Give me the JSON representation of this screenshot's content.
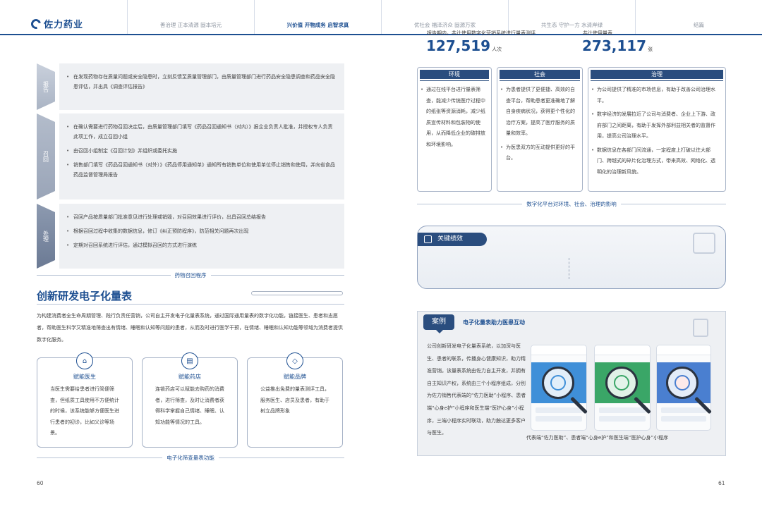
{
  "header": {
    "brand": "佐力药业",
    "nav": [
      "善治理 正本清源 固本培元",
      "兴价值 开物成务 启智求真",
      "优社会 福泽济众 固源万家",
      "共生态 守护一方 水清岸绿",
      "结篇"
    ],
    "active_index": 1
  },
  "recall": {
    "stages": [
      {
        "label": "报告",
        "items": [
          "在发现药物存在质量问题或安全隐患时，立刻反馈至质量管理部门，由质量管理部门进行药品安全隐患调查和药品安全隐患评估，并出具《调查评估报告》"
        ]
      },
      {
        "label": "召回",
        "items": [
          "在确认需要进行药物召回决定后，由质量管理部门填写《药品召回通知书（对内）》报企业负责人批准，并授权专人负责此项工作，成立召回小组",
          "由召回小组制定《召回计划》并组织或委托实施",
          "销售部门填写《药品召回通知书（对外）》《药品停用通知单》通知所有销售单位和使用单位停止销售和使用，并向省食品药品监督管理局报告"
        ]
      },
      {
        "label": "处理",
        "items": [
          "召回产品按质量部门批准意见进行处理或销毁，对召回效果进行评价，出具召回总结报告",
          "根据召回过程中收集的数据信息，修订《纠正预防程序》，防范相关问题再次出现",
          "定期对召回系统进行评估，通过模拟召回的方式进行演练"
        ]
      }
    ],
    "caption": "药物召回程序"
  },
  "scale_section": {
    "title": "创新研发电子化量表",
    "intro": "为构建消费者全生命周期管理、践行负责任营销，公司自主开发电子化量表系统，通过国际通用量表的数字化功能，链接医生、患者和志愿者，帮助医生科学又精准地筛查出有情绪、睡眠和认知等问题的患者，从而及时进行医学干预，在情绪、睡眠和认知功能等领域为消费者提供数字化服务。",
    "cards": [
      {
        "icon": "hospital-icon",
        "title": "赋能医生",
        "text": "当医生需要给患者进行简便筛查，但纸质工具使用不方便统计的时候，该系统能够方便医生进行患者的初诊，比如义诊等场景。"
      },
      {
        "icon": "store-icon",
        "title": "赋能药店",
        "text": "连锁药店可以赋能去购药的消费者，进行筛查，及时让消费者获得科学掌握自己情绪、睡眠、认知功能等情况的工具。"
      },
      {
        "icon": "diamond-icon",
        "title": "赋能品牌",
        "text": "公益推出免费的量表测评工具，服务医生、店员及患者，有助于树立品牌形象"
      }
    ],
    "caption": "电子化筛查量表功能"
  },
  "impact": {
    "columns": [
      {
        "title": "环境",
        "items": [
          "通过在线平台进行量表筛查，能减少传统医疗过程中的纸张等资源消耗，减少纸质宣传材料和包装物的使用，从而降低企业的碳排放和环境影响。"
        ]
      },
      {
        "title": "社会",
        "items": [
          "为患者提供了更便捷、高效的自查平台，帮助患者更准确地了解自身疾病状况，获得更个性化的治疗方案，提高了医疗服务的质量和效率。",
          "为医患双方的互动提供更好的平台。"
        ]
      },
      {
        "title": "治理",
        "items": [
          "为公司提供了精准的市场信息，有助于改善公司治理水平。",
          "数字经济的发展拉近了公司与消费者、企业上下游、政府部门之间距离，有助于发挥外部利益相关者的监督作用，提高公司治理水平。",
          "数据信息在各部门间流通，一定程度上打破以往大部门、跨越式的碎片化治理方式，带来高效、网络化、透明化的治理新风貌。"
        ]
      }
    ],
    "caption": "数字化平台对环境、社会、治理的影响"
  },
  "kpi": {
    "title": "关键绩效",
    "metrics": [
      {
        "label": "报告期内，共计使用数字化营销系统进行量表测评",
        "value": "127,519",
        "unit": "人次"
      },
      {
        "label": "共计使用量表",
        "value": "273,117",
        "unit": "张"
      }
    ]
  },
  "case": {
    "badge": "案例",
    "title": "电子化量表助力医患互动",
    "text": "公司创新研发电子化量表系统，以加深与医生、患者的联系，传播身心健康知识，助力精准营销。该量表系统由佐力自主开发，并拥有自主知识产权，系统由三个小程序组成，分别为佐力销售代表端的“佐力医助”小程序、患者端“心身e护”小程序和医生端“医护心身”小程序，三端小程序实时联动，助力触达更多客户与医生。",
    "caption": "代表端“佐力医助”、患者端“心身e护”和医生端“医护心身”小程序",
    "colors": [
      "#3f8fd8",
      "#3aa667",
      "#4a7fd0"
    ]
  },
  "pages": {
    "left": "60",
    "right": "61"
  }
}
